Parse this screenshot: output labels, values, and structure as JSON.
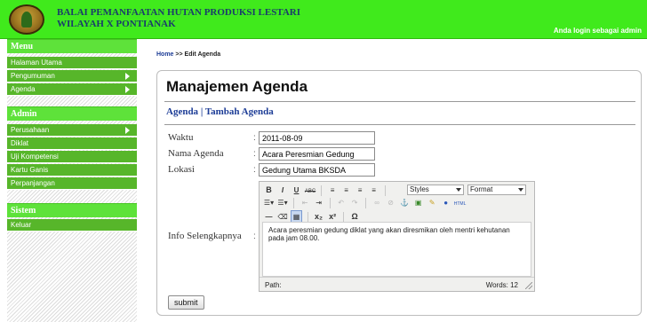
{
  "header": {
    "org_line1": "BALAI PEMANFAATAN HUTAN PRODUKSI LESTARI",
    "org_line2": "WILAYAH X PONTIANAK",
    "login_text": "Anda login sebagai admin"
  },
  "sidebar": {
    "menu_title": "Menu",
    "menu_items": [
      {
        "label": "Halaman Utama"
      },
      {
        "label": "Pengumuman"
      },
      {
        "label": "Agenda"
      }
    ],
    "admin_title": "Admin",
    "admin_items": [
      {
        "label": "Perusahaan"
      },
      {
        "label": "Diklat"
      },
      {
        "label": "Uji Kompetensi"
      },
      {
        "label": "Kartu Ganis"
      },
      {
        "label": "Perpanjangan"
      }
    ],
    "sistem_title": "Sistem",
    "sistem_items": [
      {
        "label": "Keluar"
      }
    ]
  },
  "breadcrumb": {
    "home": "Home",
    "separator": ">>",
    "current": "Edit Agenda"
  },
  "main": {
    "title": "Manajemen Agenda",
    "subnav": {
      "agenda": "Agenda",
      "separator": "|",
      "add": "Tambah Agenda"
    },
    "form": {
      "colon": ":",
      "waktu_label": "Waktu",
      "waktu_value": "2011-08-09",
      "nama_label": "Nama Agenda",
      "nama_value": "Acara Peresmian Gedung",
      "lokasi_label": "Lokasi",
      "lokasi_value": "Gedung Utama BKSDA",
      "info_label": "Info Selengkapnya",
      "submit_label": "submit"
    },
    "editor": {
      "styles_select": "Styles",
      "format_select": "Format",
      "content": "Acara peresmian gedung diklat yang akan diresmikan oleh mentri kehutanan pada jam 08.00.",
      "path_label": "Path:",
      "words_label": "Words: 12"
    }
  }
}
